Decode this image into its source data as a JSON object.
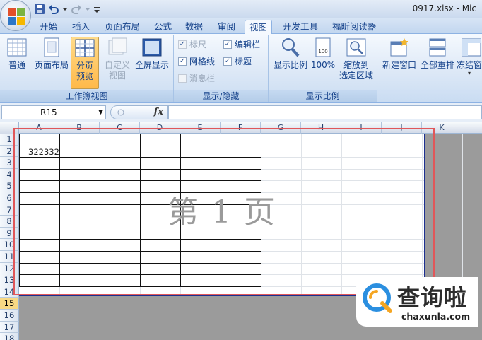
{
  "window": {
    "title": "0917.xlsx - Mic"
  },
  "tabs": [
    {
      "label": "开始"
    },
    {
      "label": "插入"
    },
    {
      "label": "页面布局"
    },
    {
      "label": "公式"
    },
    {
      "label": "数据"
    },
    {
      "label": "审阅"
    },
    {
      "label": "视图"
    },
    {
      "label": "开发工具"
    },
    {
      "label": "福昕阅读器"
    }
  ],
  "active_tab": "视图",
  "ribbon": {
    "workbook_views": {
      "label": "工作簿视图",
      "normal": "普通",
      "page_layout": "页面布局",
      "page_break_1": "分页",
      "page_break_2": "预览",
      "custom_1": "自定义",
      "custom_2": "视图",
      "full_screen": "全屏显示"
    },
    "show_hide": {
      "label": "显示/隐藏",
      "ruler": "标尺",
      "gridlines": "网格线",
      "message_bar": "消息栏",
      "formula_bar": "编辑栏",
      "headings": "标题",
      "ruler_checked": true,
      "gridlines_checked": true,
      "message_bar_checked": false,
      "formula_bar_checked": true,
      "headings_checked": true
    },
    "zoom": {
      "label": "显示比例",
      "zoom": "显示比例",
      "zoom_100": "100%",
      "zoom_sel_1": "缩放到",
      "zoom_sel_2": "选定区域"
    },
    "window_group": {
      "new_window": "新建窗口",
      "arrange_all": "全部重排",
      "freeze": "冻结窗"
    }
  },
  "formula_bar": {
    "name_box": "R15",
    "fx": "fx",
    "value": ""
  },
  "sheet": {
    "columns": [
      "A",
      "B",
      "C",
      "D",
      "E",
      "F",
      "G",
      "H",
      "I",
      "J",
      "K"
    ],
    "rows": [
      "1",
      "2",
      "3",
      "4",
      "5",
      "6",
      "7",
      "8",
      "9",
      "10",
      "11",
      "12",
      "13",
      "14",
      "15",
      "16",
      "17",
      "18"
    ],
    "active_row": "15",
    "cell_a2": "322332",
    "page_watermark": "第 1 页"
  },
  "logo": {
    "cn": "查询啦",
    "en": "chaxunla.com"
  },
  "colors": {
    "page_border": "#1c2f8f",
    "highlight_box": "#e0575a",
    "active_button": "#ffb94a"
  }
}
